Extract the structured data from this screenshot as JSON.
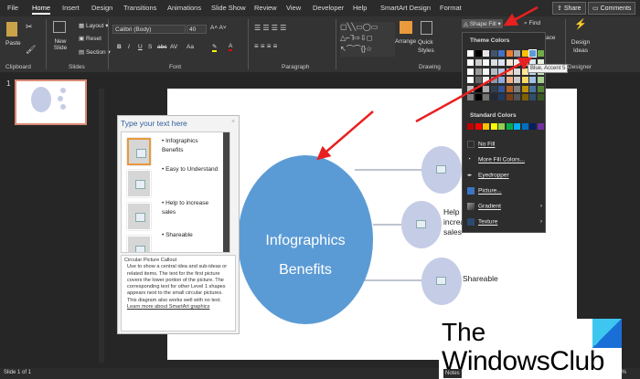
{
  "tabs": [
    "File",
    "Home",
    "Insert",
    "Design",
    "Transitions",
    "Animations",
    "Slide Show",
    "Review",
    "View",
    "Developer",
    "Help",
    "SmartArt Design",
    "Format"
  ],
  "active_tab": "Home",
  "share": "Share",
  "comments": "Comments",
  "ribbon": {
    "clipboard": {
      "paste": "Paste",
      "label": "Clipboard"
    },
    "slides": {
      "new_slide": "New Slide",
      "layout": "Layout",
      "reset": "Reset",
      "section": "Section",
      "label": "Slides"
    },
    "font": {
      "name": "Calibri (Body)",
      "size": "40",
      "label": "Font",
      "buttons": [
        "B",
        "I",
        "U",
        "S",
        "abc",
        "AV",
        "Aa"
      ]
    },
    "paragraph": {
      "label": "Paragraph"
    },
    "drawing": {
      "arrange": "Arrange",
      "quick_styles": "Quick Styles",
      "label": "Drawing",
      "shape_fill": "Shape Fill",
      "find": "Find",
      "replace": "ace"
    },
    "designer": {
      "design_ideas": "Design Ideas",
      "label": "Designer"
    }
  },
  "slide_number": "1",
  "text_pane": {
    "title": "Type your text here",
    "bullets": [
      "Infographics Benefits",
      "Easy to Understand",
      "Help to increase sales",
      "Shareable"
    ],
    "desc_title": "Circular Picture Callout",
    "desc": "Use to show a central idea and sub-ideas or related items. The text for the first picture covers the lower portion of the picture. The corresponding text for other Level 1 shapes appears next to the small circular pictures. This diagram also works well with no text.",
    "link": "Learn more about SmartArt graphics"
  },
  "smartart": {
    "center_text_1": "Infographics",
    "center_text_2": "Benefits",
    "item2": "Help to increase sales",
    "item2_visible_1": "Help",
    "item2_visible_2": "increa",
    "item2_visible_3": "sales",
    "item3": "Shareable",
    "center_color": "#5b9bd5",
    "small_color": "#c5cce6"
  },
  "menu": {
    "theme_colors": "Theme Colors",
    "standard_colors": "Standard Colors",
    "theme": [
      "#ffffff",
      "#000000",
      "#e7e6e6",
      "#44546a",
      "#4472c4",
      "#ed7d31",
      "#a5a5a5",
      "#ffc000",
      "#5b9bd5",
      "#70ad47"
    ],
    "standard": [
      "#c00000",
      "#ff0000",
      "#ffc000",
      "#ffff00",
      "#92d050",
      "#00b050",
      "#00b0f0",
      "#0070c0",
      "#002060",
      "#7030a0"
    ],
    "items": [
      "No Fill",
      "More Fill Colors...",
      "Eyedropper",
      "Picture...",
      "Gradient",
      "Texture"
    ],
    "tooltip": "Blue, Accent 5"
  },
  "status": {
    "slide": "Slide 1 of 1",
    "notes": "Notes",
    "zoom": "68%"
  },
  "watermark": {
    "line1": "The",
    "line2": "WindowsClub"
  }
}
